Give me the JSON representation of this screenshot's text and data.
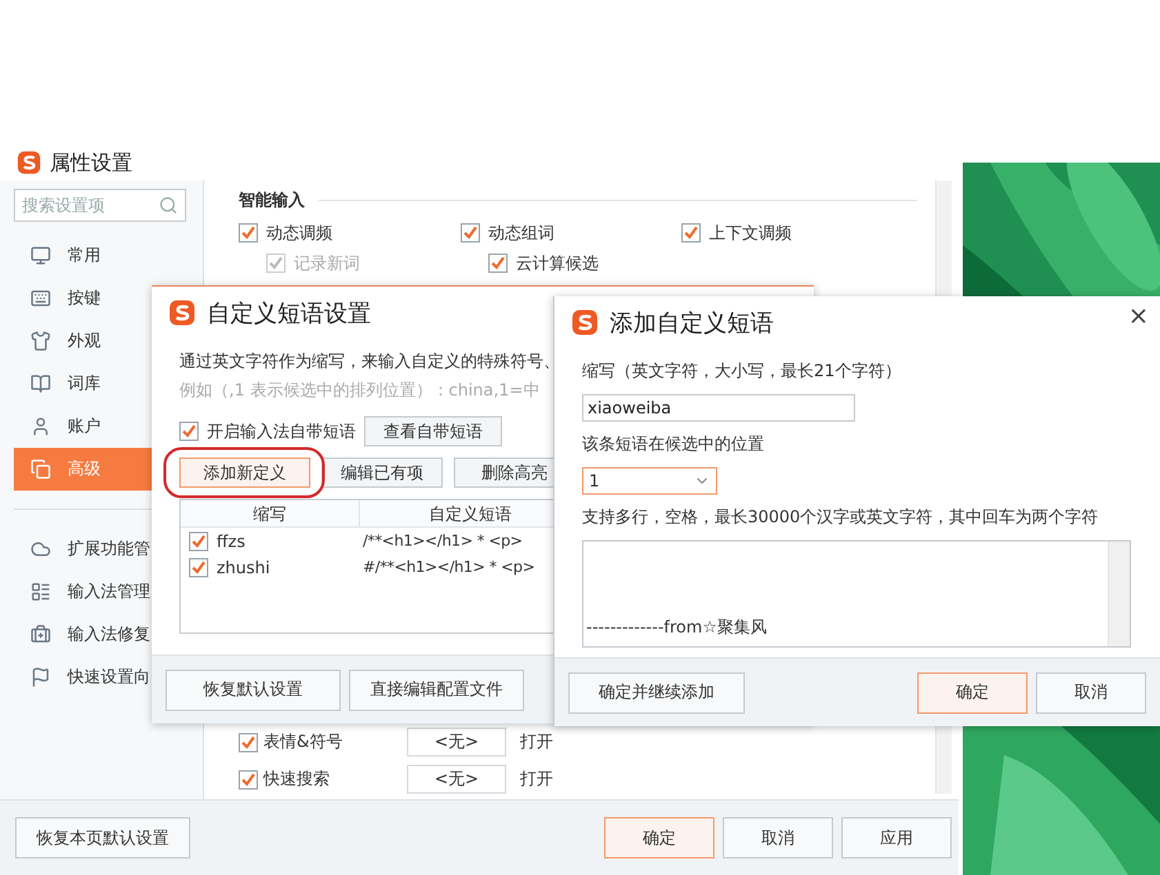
{
  "settings_window": {
    "title": "属性设置",
    "search": {
      "placeholder": "搜索设置项"
    },
    "sidebar": {
      "items": [
        {
          "label": "常用",
          "selected": false
        },
        {
          "label": "按键",
          "selected": false
        },
        {
          "label": "外观",
          "selected": false
        },
        {
          "label": "词库",
          "selected": false
        },
        {
          "label": "账户",
          "selected": false
        },
        {
          "label": "高级",
          "selected": true
        }
      ],
      "tools": [
        {
          "label": "扩展功能管"
        },
        {
          "label": "输入法管理"
        },
        {
          "label": "输入法修复"
        },
        {
          "label": "快速设置向"
        }
      ]
    },
    "section_title": "智能输入",
    "options": [
      {
        "label": "动态调频",
        "checked": true,
        "disabled": false
      },
      {
        "label": "动态组词",
        "checked": true,
        "disabled": false
      },
      {
        "label": "上下文调频",
        "checked": true,
        "disabled": false
      },
      {
        "label": "记录新词",
        "checked": true,
        "disabled": true
      },
      {
        "label": "云计算候选",
        "checked": true,
        "disabled": false
      }
    ],
    "shortcut_rows": [
      {
        "label": "表情&符号",
        "checked": true,
        "key": "<无>",
        "action": "打开"
      },
      {
        "label": "快速搜索",
        "checked": true,
        "key": "<无>",
        "action": "打开"
      }
    ],
    "restore_button": "恢复本页默认设置",
    "buttons": [
      {
        "label": "确定",
        "primary": true
      },
      {
        "label": "取消",
        "primary": false
      },
      {
        "label": "应用",
        "primary": false
      }
    ]
  },
  "phrase_dialog": {
    "title": "自定义短语设置",
    "description": "通过英文字符作为缩写，来输入自定义的特殊符号、",
    "example": "例如（,1 表示候选中的排列位置）：china,1=中",
    "builtin": {
      "label": "开启输入法自带短语",
      "checked": true,
      "button": "查看自带短语"
    },
    "actions": [
      {
        "label": "添加新定义",
        "primary": true
      },
      {
        "label": "编辑已有项",
        "primary": false
      },
      {
        "label": "删除高亮",
        "primary": false
      }
    ],
    "table": {
      "columns": [
        "缩写",
        "自定义短语"
      ],
      "rows": [
        {
          "checked": true,
          "abbr": "ffzs",
          "phrase": "/**<h1></h1> * <p>"
        },
        {
          "checked": true,
          "abbr": "zhushi",
          "phrase": "#/**<h1></h1> * <p>"
        }
      ]
    },
    "footer_buttons": [
      "恢复默认设置",
      "直接编辑配置文件"
    ]
  },
  "add_dialog": {
    "title": "添加自定义短语",
    "close": "×",
    "abbr_label": "缩写（英文字符，大小写，最长21个字符）",
    "abbr_value": "xiaoweiba",
    "position_label": "该条短语在候选中的位置",
    "position_value": "1",
    "content_label": "支持多行，空格，最长30000个汉字或英文字符，其中回车为两个字符",
    "content_value": "-------------from☆聚集风",
    "buttons": [
      {
        "label": "确定并继续添加",
        "primary": false
      },
      {
        "label": "确定",
        "primary": true
      },
      {
        "label": "取消",
        "primary": false
      }
    ]
  }
}
